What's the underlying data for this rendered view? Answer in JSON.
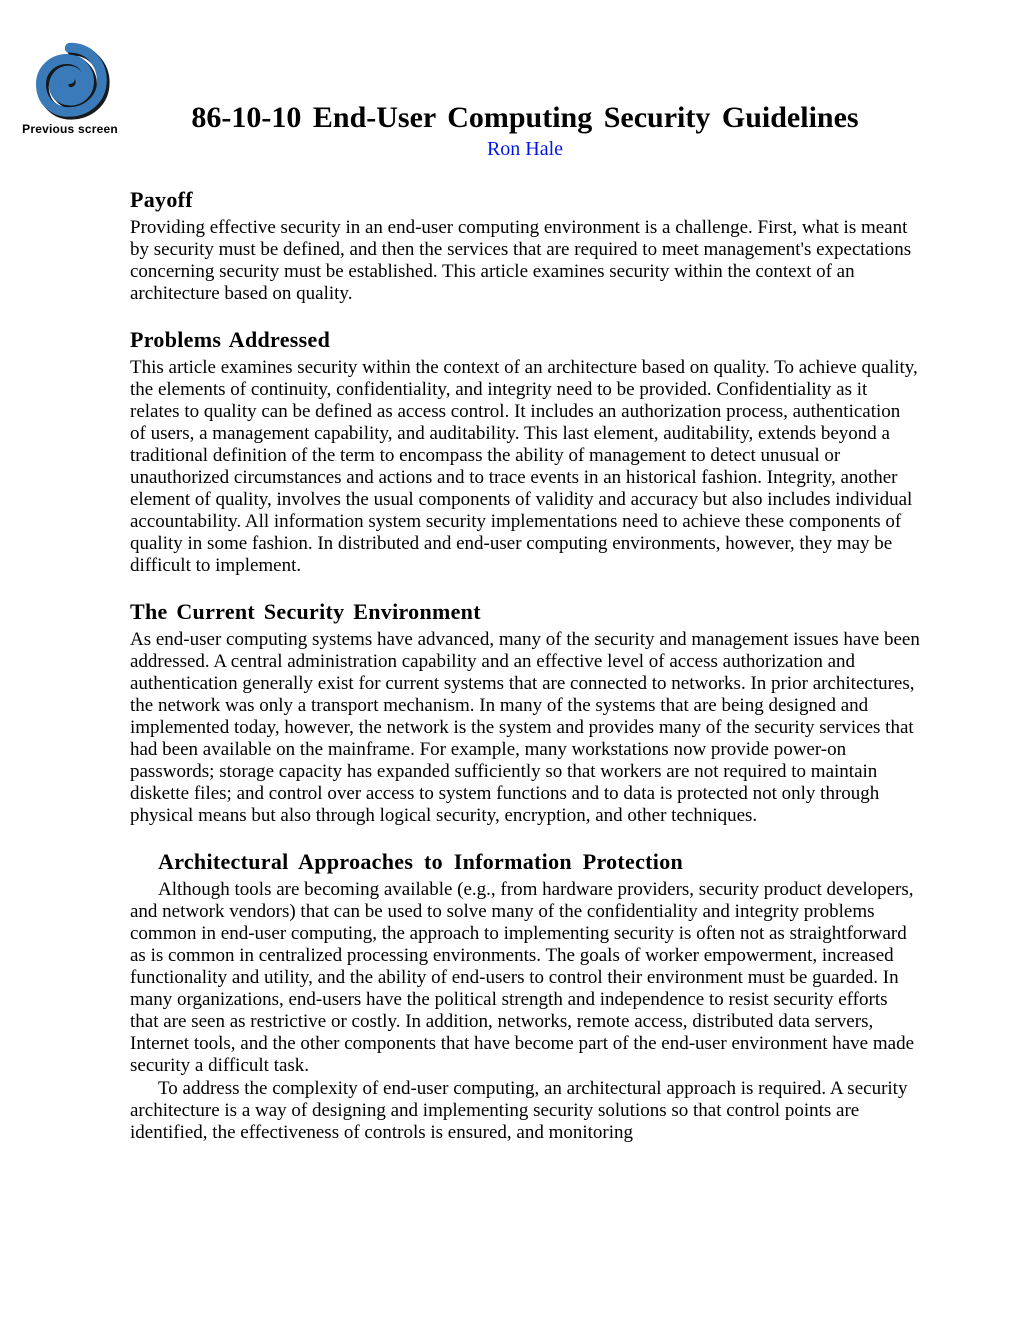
{
  "nav": {
    "previous_label": "Previous screen"
  },
  "header": {
    "title": "86-10-10  End-User  Computing  Security  Guidelines",
    "author": "Ron Hale"
  },
  "sections": {
    "payoff": {
      "heading": "Payoff",
      "body": "Providing effective security in an end-user computing environment is a challenge. First, what is meant by security must be defined, and then the services that are required to meet management's expectations concerning security must be established. This article examines security within the context of an architecture based on quality."
    },
    "problems": {
      "heading": "Problems  Addressed",
      "body": "This article examines security within the context of an architecture based on quality. To achieve quality, the elements of continuity, confidentiality, and integrity need to be provided. Confidentiality as it relates to quality can be defined as access control. It includes an authorization process, authentication of users, a management capability, and auditability. This last element, auditability, extends beyond a traditional definition of the term to encompass the ability of management to detect unusual or unauthorized circumstances and actions and to trace events in an historical fashion. Integrity, another element of quality, involves the usual components of validity and accuracy but also includes individual accountability. All information system security implementations need to achieve these components of quality in some fashion. In distributed and end-user computing environments, however, they may be difficult to implement."
    },
    "current_env": {
      "heading": "The  Current  Security  Environment",
      "body": "As end-user computing systems have advanced, many of the security and management issues have been addressed. A central administration capability and an effective level of access authorization and authentication generally exist for current systems that are connected to networks. In prior architectures, the network was only a transport mechanism. In many of the systems that are being designed and implemented today, however, the network is the system and provides many of the security services that had been available on the mainframe. For example, many workstations now provide power-on passwords; storage capacity has expanded sufficiently so that workers are not required to maintain diskette files; and control over access to system functions and to data is protected not only through physical means but also through logical security, encryption, and other techniques."
    },
    "arch": {
      "heading": "Architectural  Approaches  to  Information  Protection",
      "p1": "Although tools are becoming available (e.g., from hardware providers, security product developers, and network vendors) that can be used to solve many of the confidentiality and integrity problems common in end-user computing, the approach to implementing security is often not as straightforward as is common in centralized processing environments. The goals of worker empowerment, increased functionality and utility, and the ability of end-users to control their environment must be guarded. In many organizations, end-users have the political strength and independence to resist security efforts that are seen as restrictive or costly. In addition, networks, remote access, distributed data servers, Internet tools, and the other components that have become part of the end-user environment have made security a difficult task.",
      "p2": "To address the complexity of end-user computing, an architectural approach is required. A security architecture is a way of designing and implementing security solutions so that control points are identified, the effectiveness of controls is ensured, and monitoring"
    }
  }
}
